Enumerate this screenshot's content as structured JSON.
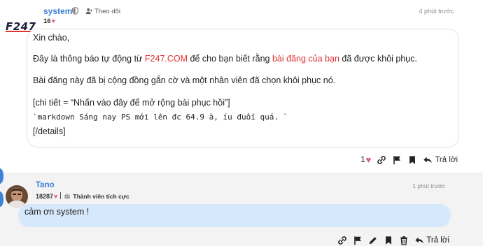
{
  "post1": {
    "username": "system",
    "follow_label": "Theo dõi",
    "time": "4 phút trước",
    "score": "16",
    "avatar_text": "F247",
    "greeting": "Xin chào,",
    "line1_before": "Đây là thông báo tự động từ ",
    "line1_link1": "F247.COM",
    "line1_mid": " để cho bạn biết rằng ",
    "line1_link2": "bài đăng của bạn",
    "line1_after": " đã được khôi phục.",
    "line2": "Bài đăng này đã bị cộng đồng gắn cờ và một nhân viên đã chọn khôi phục nó.",
    "details_open": "[chi tiết = “Nhấn vào đây để mở rộng bài phục hồi”]",
    "code_line": "`markdown Sáng nay PS mới lên đc 64.9 à, íu đuối quá. `",
    "details_close": "[/details]",
    "like_count": "1",
    "reply_label": "Trả lời"
  },
  "post2": {
    "username": "Tano",
    "time": "1 phút trước",
    "score": "18287",
    "badge": "Thành viên tích cực",
    "message": "cảm ơn system !",
    "reply_label": "Trả lời"
  },
  "colors": {
    "username": "#3d7fd6",
    "link": "#e03030",
    "heart": "#e35b7a",
    "reply_bubble": "#d6e8fb",
    "post2_background": "#f3f3f3"
  },
  "icons": {
    "post1_actions": [
      "heart-icon",
      "link-icon",
      "flag-icon",
      "bookmark-icon",
      "reply-icon"
    ],
    "post2_actions": [
      "link-icon",
      "flag-icon",
      "edit-icon",
      "bookmark-icon",
      "trash-icon",
      "reply-icon"
    ]
  }
}
